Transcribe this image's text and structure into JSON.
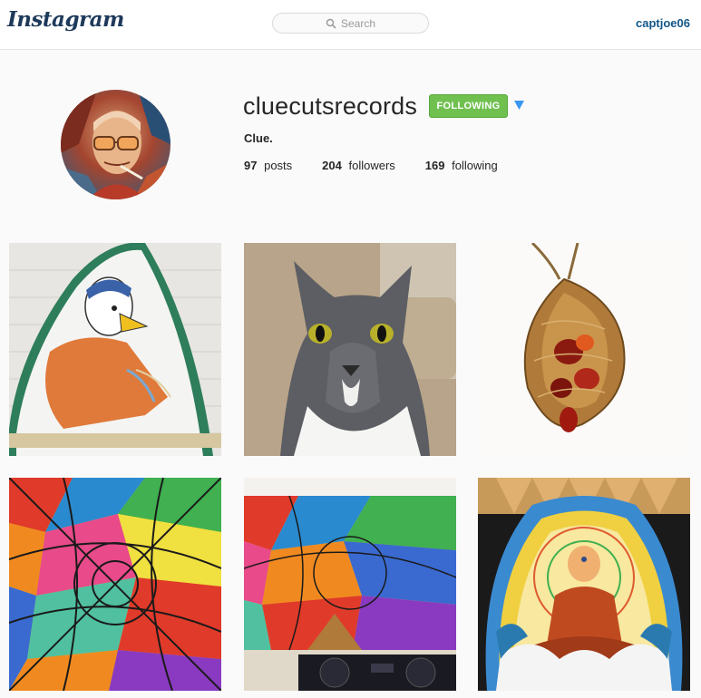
{
  "header": {
    "logo_text": "Instagram",
    "search_placeholder": "Search",
    "username": "captjoe06"
  },
  "profile": {
    "name": "cluecutsrecords",
    "follow_label": "FOLLOWING",
    "bio": "Clue.",
    "stats": [
      {
        "count": "97",
        "label": "posts"
      },
      {
        "count": "204",
        "label": "followers"
      },
      {
        "count": "169",
        "label": "following"
      }
    ]
  },
  "colors": {
    "brand_blue": "#125688",
    "follow_green": "#70c050"
  },
  "posts": [
    {
      "subject": "surfboard-art"
    },
    {
      "subject": "cat-photo"
    },
    {
      "subject": "wire-wrapped-pendant"
    },
    {
      "subject": "stained-glass-painting"
    },
    {
      "subject": "mural-with-turntables"
    },
    {
      "subject": "buddha-surfboard"
    }
  ]
}
